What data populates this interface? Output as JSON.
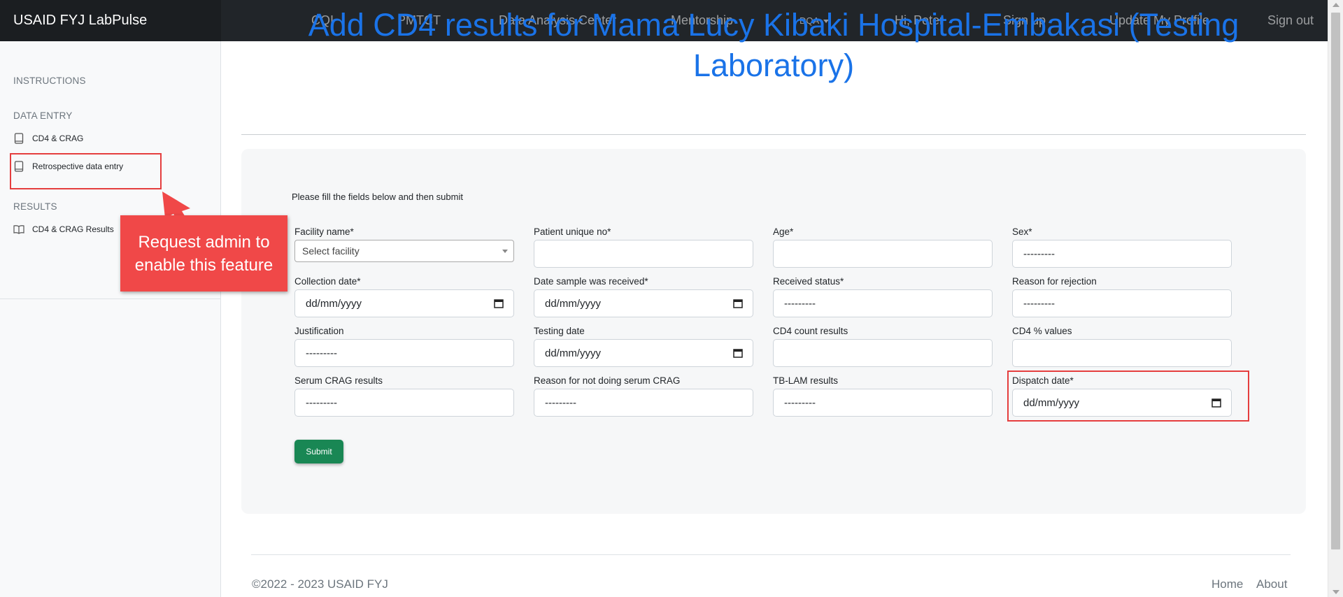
{
  "navbar": {
    "brand": "USAID FYJ LabPulse",
    "links": [
      "CQI",
      "PMTCT",
      "Data Analysis Center",
      "Mentorship"
    ],
    "dqa_label": "DQA",
    "greeting": "Hi, Peter",
    "sign_up": "Sign up",
    "update_profile": "Update My Profile",
    "sign_out": "Sign out"
  },
  "sidebar": {
    "instructions": "INSTRUCTIONS",
    "data_entry_heading": "DATA ENTRY",
    "cd4_crag": "CD4 & CRAG",
    "retrospective": "Retrospective data entry",
    "results_heading": "RESULTS",
    "cd4_crag_results": "CD4 & CRAG Results"
  },
  "page": {
    "title": "Add CD4 results for Mama Lucy Kibaki Hospital-Embakasi (Testing Laboratory)",
    "intro": "Please fill the fields below and then submit"
  },
  "form": {
    "facility_name": {
      "label": "Facility name*",
      "value": "Select facility"
    },
    "patient_unique_no": {
      "label": "Patient unique no*",
      "value": ""
    },
    "age": {
      "label": "Age*",
      "value": ""
    },
    "sex": {
      "label": "Sex*",
      "value": "---------"
    },
    "collection_date": {
      "label": "Collection date*",
      "value": "dd/mm/yyyy"
    },
    "date_received": {
      "label": "Date sample was received*",
      "value": "dd/mm/yyyy"
    },
    "received_status": {
      "label": "Received status*",
      "value": "---------"
    },
    "reason_rejection": {
      "label": "Reason for rejection",
      "value": "---------"
    },
    "justification": {
      "label": "Justification",
      "value": "---------"
    },
    "testing_date": {
      "label": "Testing date",
      "value": "dd/mm/yyyy"
    },
    "cd4_count": {
      "label": "CD4 count results",
      "value": ""
    },
    "cd4_percent": {
      "label": "CD4 % values",
      "value": ""
    },
    "serum_crag": {
      "label": "Serum CRAG results",
      "value": "---------"
    },
    "reason_no_crag": {
      "label": "Reason for not doing serum CRAG",
      "value": "---------"
    },
    "tb_lam": {
      "label": "TB-LAM results",
      "value": "---------"
    },
    "dispatch_date": {
      "label": "Dispatch date*",
      "value": "dd/mm/yyyy"
    },
    "submit_label": "Submit"
  },
  "footer": {
    "copyright": "©2022 - 2023 USAID FYJ",
    "home": "Home",
    "about": "About"
  },
  "annotation": {
    "callout_text": "Request admin to enable this feature",
    "highlight_color": "#e53e3e",
    "callout_color": "#f04848"
  },
  "colors": {
    "title_blue": "#1a73e8",
    "submit_green": "#198754",
    "navbar_dark": "#212529"
  }
}
